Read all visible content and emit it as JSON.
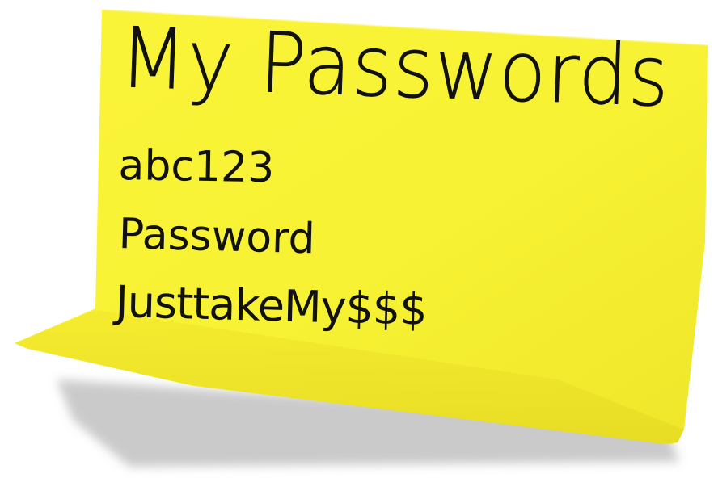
{
  "note": {
    "title": "My Passwords",
    "entries": [
      "abc123",
      "Password",
      "JusttakeMy$$$"
    ]
  },
  "colors": {
    "note": "#f7f233",
    "note_fold": "#ece52a",
    "shadow": "#b9b9b9",
    "ink": "#111111",
    "background": "#ffffff"
  }
}
